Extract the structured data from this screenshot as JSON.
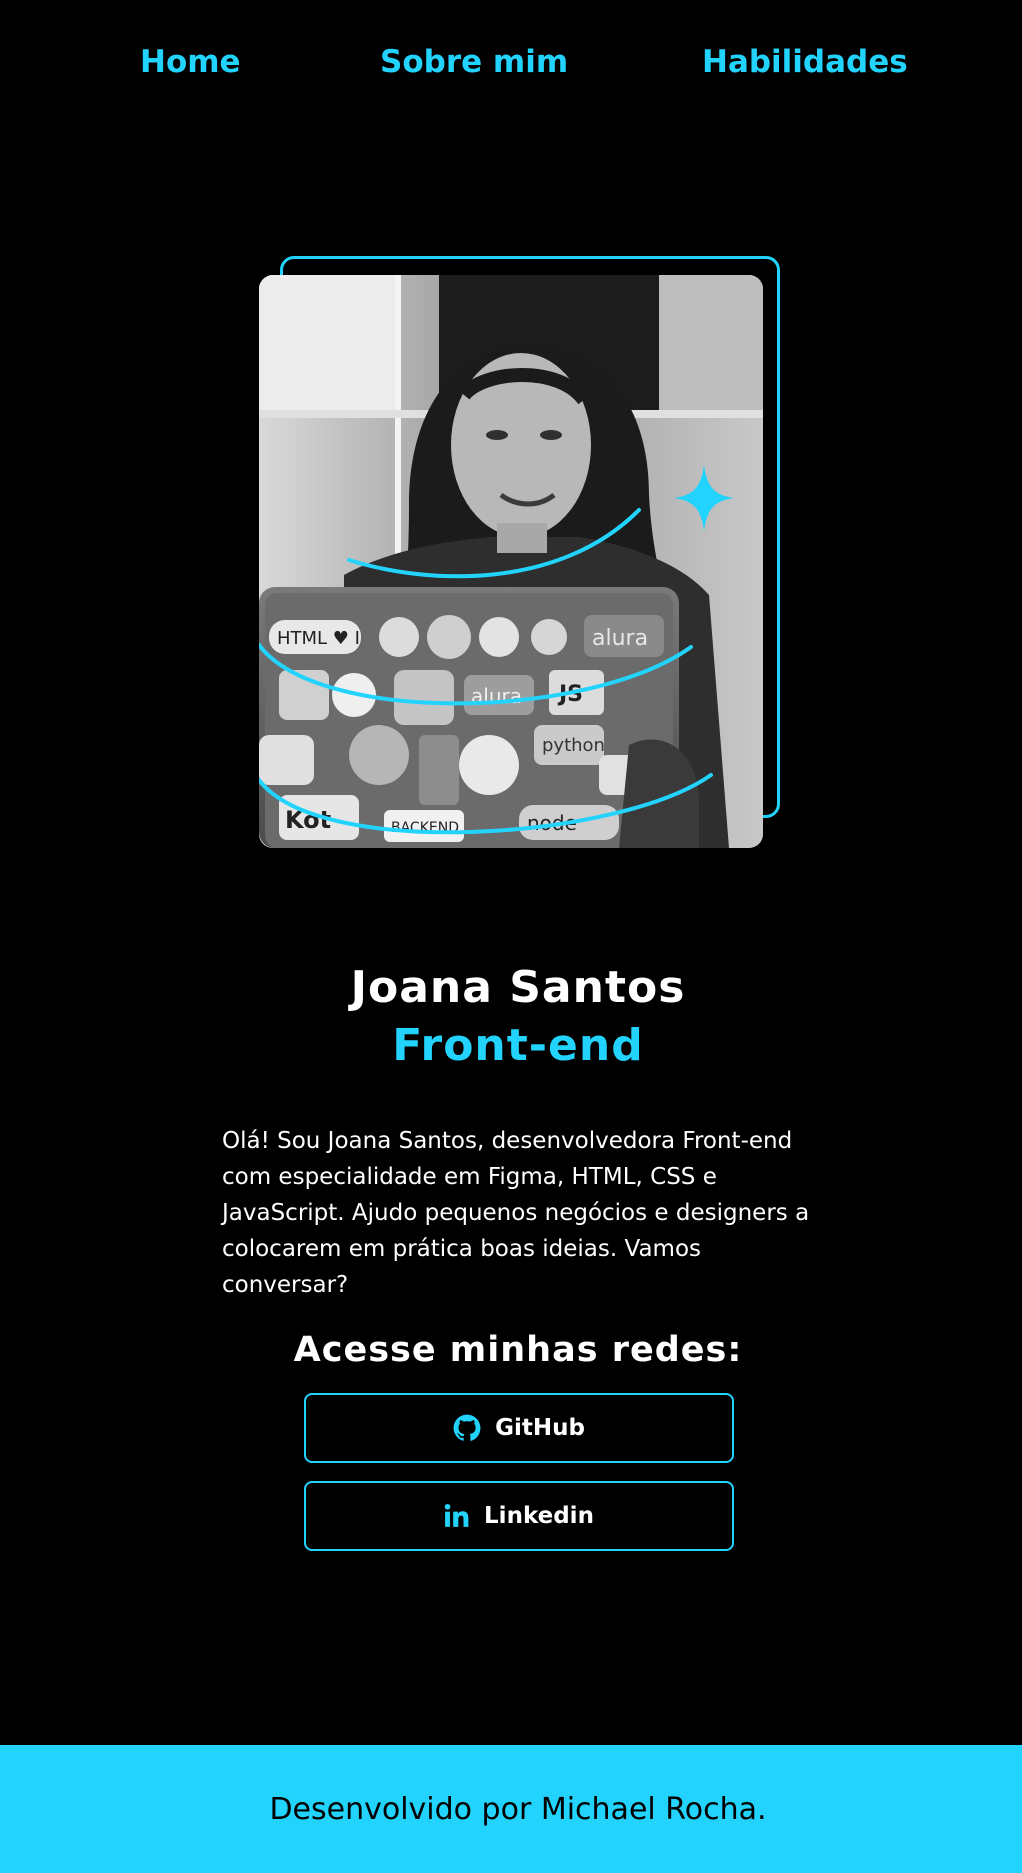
{
  "nav": {
    "items": [
      {
        "label": "Home"
      },
      {
        "label": "Sobre mim"
      },
      {
        "label": "Habilidades"
      }
    ]
  },
  "hero": {
    "photo_icon": "profile-photo",
    "sparkle_icon": "sparkle-icon"
  },
  "profile": {
    "name": "Joana Santos",
    "role": "Front-end",
    "bio": "Olá! Sou Joana Santos, desenvolvedora Front-end com especialidade em Figma, HTML, CSS e JavaScript. Ajudo pequenos negócios e designers a colocarem em prática boas ideias. Vamos conversar?"
  },
  "networks": {
    "title": "Acesse minhas redes:",
    "buttons": [
      {
        "label": "GitHub",
        "icon": "github-icon"
      },
      {
        "label": "Linkedin",
        "icon": "linkedin-icon"
      }
    ]
  },
  "footer": {
    "text": "Desenvolvido por Michael Rocha."
  },
  "colors": {
    "accent": "#22d4fd",
    "background": "#000000",
    "text": "#ffffff"
  }
}
